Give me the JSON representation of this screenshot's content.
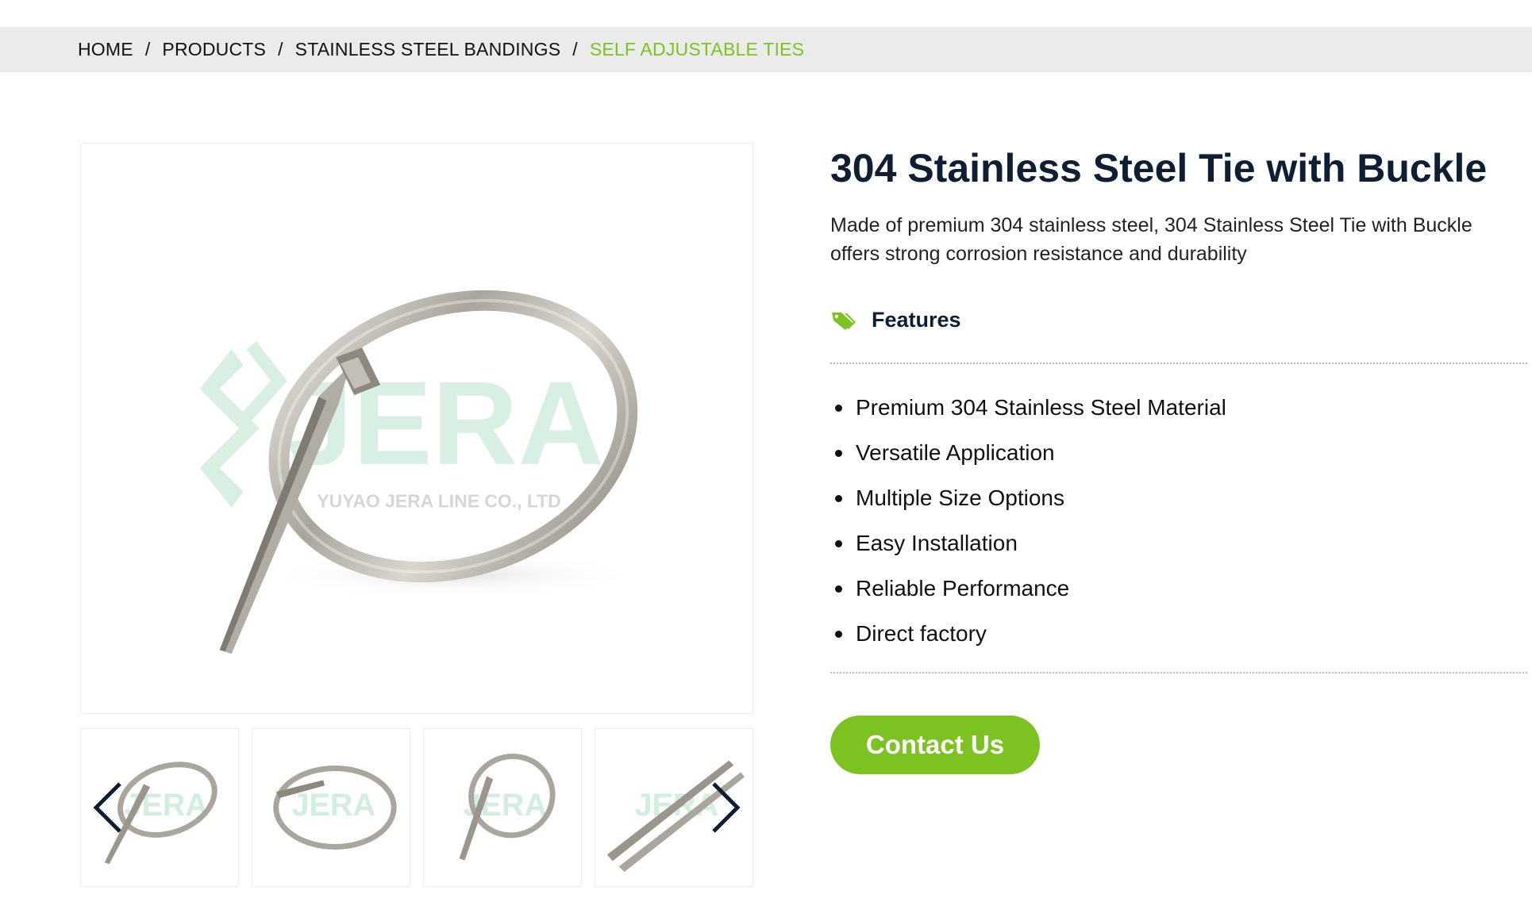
{
  "breadcrumb": {
    "items": [
      "HOME",
      "PRODUCTS",
      "STAINLESS STEEL BANDINGS"
    ],
    "current": "SELF ADJUSTABLE TIES",
    "separator": "/"
  },
  "gallery": {
    "watermark_brand": "JERA",
    "watermark_company": "YUYAO JERA LINE CO., LTD",
    "thumbnail_count": 4,
    "prev_icon": "chevron-left-icon",
    "next_icon": "chevron-right-icon"
  },
  "product": {
    "title": "304 Stainless Steel Tie with Buckle",
    "description": "Made of premium 304 stainless steel, 304 Stainless Steel Tie with Buckle offers strong corrosion resistance and durability",
    "features_heading": "Features",
    "features_icon": "tag-icon",
    "features": [
      "Premium 304 Stainless Steel Material",
      "Versatile Application",
      "Multiple Size Options",
      "Easy Installation",
      "Reliable Performance",
      "Direct factory"
    ],
    "contact_label": "Contact Us"
  },
  "colors": {
    "accent": "#7cc322",
    "title": "#0e1f33",
    "breadcrumb_bg": "#ebebeb",
    "watermark": "#d2eedf"
  }
}
